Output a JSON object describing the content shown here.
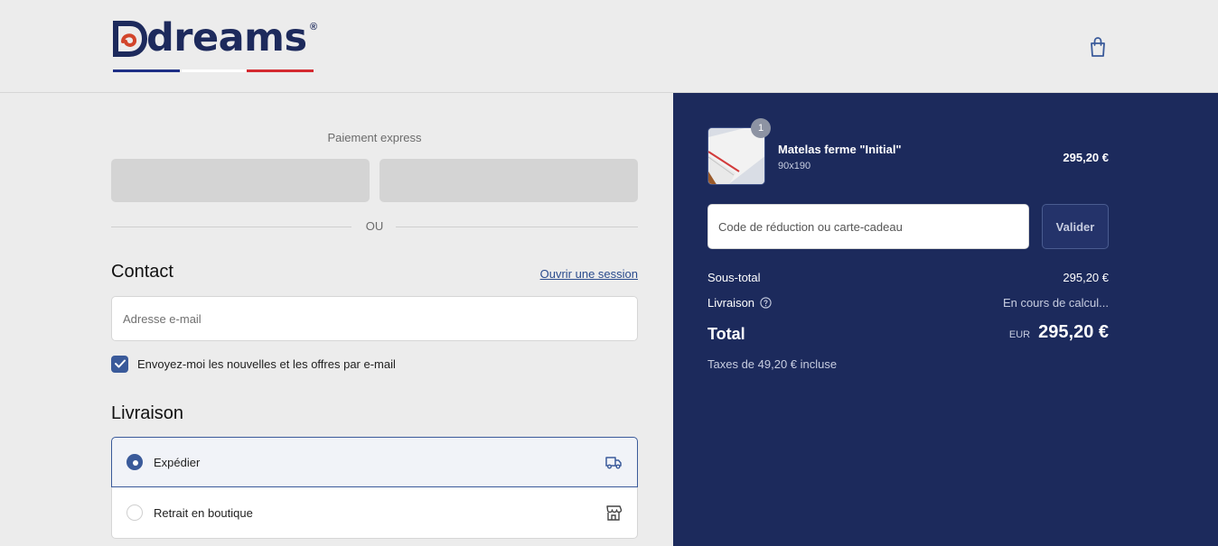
{
  "brand": {
    "name": "dreams",
    "registered_mark": "®"
  },
  "express": {
    "title": "Paiement express",
    "separator": "OU"
  },
  "contact": {
    "title": "Contact",
    "login_link": "Ouvrir une session",
    "email_placeholder": "Adresse e-mail",
    "newsletter_label": "Envoyez-moi les nouvelles et les offres par e-mail",
    "newsletter_checked": true
  },
  "delivery": {
    "title": "Livraison",
    "options": [
      {
        "label": "Expédier",
        "selected": true,
        "icon": "truck-icon"
      },
      {
        "label": "Retrait en boutique",
        "selected": false,
        "icon": "store-icon"
      }
    ]
  },
  "summary": {
    "product": {
      "name": "Matelas ferme \"Initial\"",
      "variant": "90x190",
      "price": "295,20 €",
      "quantity": "1"
    },
    "discount_placeholder": "Code de réduction ou carte-cadeau",
    "validate_label": "Valider",
    "subtotal_label": "Sous-total",
    "subtotal_value": "295,20 €",
    "shipping_label": "Livraison",
    "shipping_value": "En cours de calcul...",
    "total_label": "Total",
    "currency": "EUR",
    "total_value": "295,20 €",
    "tax_note": "Taxes de 49,20 € incluse"
  },
  "colors": {
    "navy": "#1c2a5c",
    "accent": "#3a5a9a",
    "flag_blue": "#1e2f86",
    "flag_red": "#d42a30"
  }
}
